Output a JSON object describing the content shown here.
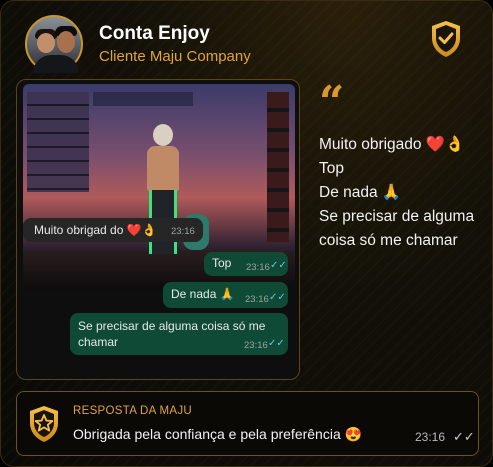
{
  "header": {
    "name": "Conta Enjoy",
    "client": "Cliente Maju Company"
  },
  "quote_icon": "quote-icon",
  "chat": {
    "messages": [
      {
        "direction": "in",
        "text": "Muito obrigad do ❤️👌",
        "time": "23:16"
      },
      {
        "direction": "out",
        "text": "Top",
        "time": "23:16"
      },
      {
        "direction": "out",
        "text": "De nada 🙏",
        "time": "23:16"
      },
      {
        "direction": "out",
        "text": "Se precisar de alguma coisa só me chamar",
        "time": "23:16"
      }
    ]
  },
  "transcript": {
    "lines": [
      "Muito obrigado ❤️👌",
      "Top",
      "De nada 🙏",
      "Se precisar de alguma",
      "coisa só me chamar"
    ]
  },
  "reply": {
    "title": "RESPOSTA DA MAJU",
    "message": "Obrigada pela confiança e pela preferência 😍",
    "time": "23:16"
  },
  "colors": {
    "accent_gold": "#e0a43a",
    "outgoing_bubble": "#0f4a36",
    "incoming_bubble": "#262626"
  }
}
